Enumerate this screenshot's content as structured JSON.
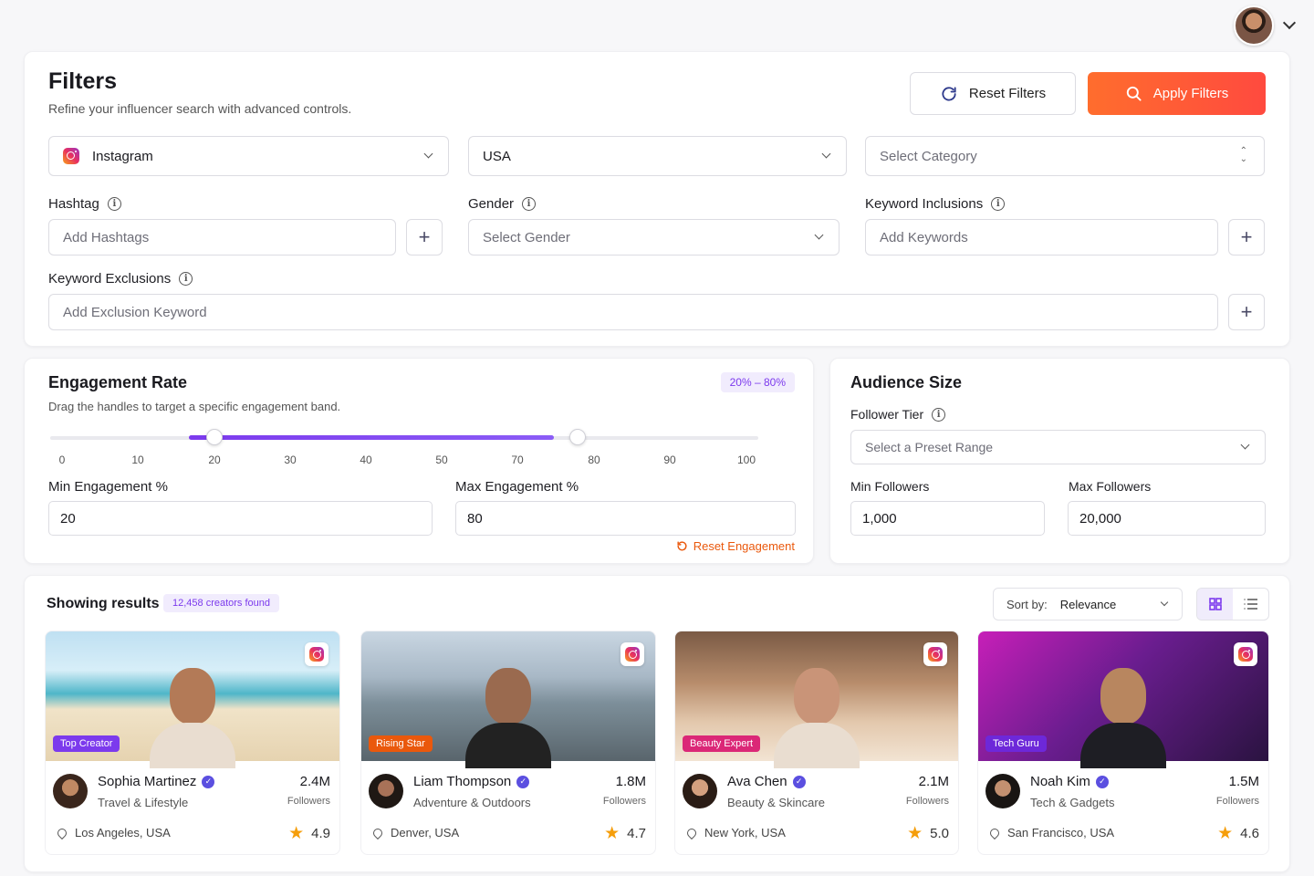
{
  "filters": {
    "title": "Filters",
    "subtitle": "Refine your influencer search with advanced controls.",
    "reset_label": "Reset Filters",
    "apply_label": "Apply Filters",
    "platform": "Instagram",
    "country": "USA",
    "category_placeholder": "Select Category",
    "hashtag_label": "Hashtag",
    "hashtag_placeholder": "Add Hashtags",
    "gender_label": "Gender",
    "gender_placeholder": "Select Gender",
    "keyword_incl_label": "Keyword Inclusions",
    "keyword_incl_placeholder": "Add Keywords",
    "keyword_excl_label": "Keyword Exclusions",
    "keyword_excl_placeholder": "Add Exclusion Keyword"
  },
  "engagement": {
    "title": "Engagement Rate",
    "subtitle": "Drag the handles to target a specific engagement band.",
    "range_pill": "20% – 80%",
    "ticks": [
      "0",
      "10",
      "20",
      "30",
      "40",
      "50",
      "70",
      "80",
      "90",
      "100"
    ],
    "min_value": 20,
    "max_value": 80,
    "min_label": "Min Engagement %",
    "max_label": "Max Engagement %",
    "min_input": "20",
    "max_input": "80",
    "reset_label": "Reset Engagement"
  },
  "audience": {
    "title": "Audience Size",
    "tier_label": "Follower Tier",
    "tier_placeholder": "Select a Preset Range",
    "min_label": "Min Followers",
    "max_label": "Max Followers",
    "min_value": "1,000",
    "max_value": "20,000"
  },
  "results": {
    "title": "Showing results",
    "count": "12,458 creators found",
    "sort_label": "Sort by:",
    "sort_value": "Relevance"
  },
  "creators": [
    {
      "name": "Sophia Martinez",
      "niche": "Travel & Lifestyle",
      "followers": "2.4M",
      "followers_label": "Followers",
      "location": "Los Angeles, USA",
      "rating": "4.9",
      "badge": "Top Creator",
      "badge_color": "#7c3aed"
    },
    {
      "name": "Liam Thompson",
      "niche": "Adventure & Outdoors",
      "followers": "1.8M",
      "followers_label": "Followers",
      "location": "Denver, USA",
      "rating": "4.7",
      "badge": "Rising Star",
      "badge_color": "#ea580c"
    },
    {
      "name": "Ava Chen",
      "niche": "Beauty & Skincare",
      "followers": "2.1M",
      "followers_label": "Followers",
      "location": "New York, USA",
      "rating": "5.0",
      "badge": "Beauty Expert",
      "badge_color": "#db2777"
    },
    {
      "name": "Noah Kim",
      "niche": "Tech & Gadgets",
      "followers": "1.5M",
      "followers_label": "Followers",
      "location": "San Francisco, USA",
      "rating": "4.6",
      "badge": "Tech Guru",
      "badge_color": "#6d28d9"
    }
  ]
}
